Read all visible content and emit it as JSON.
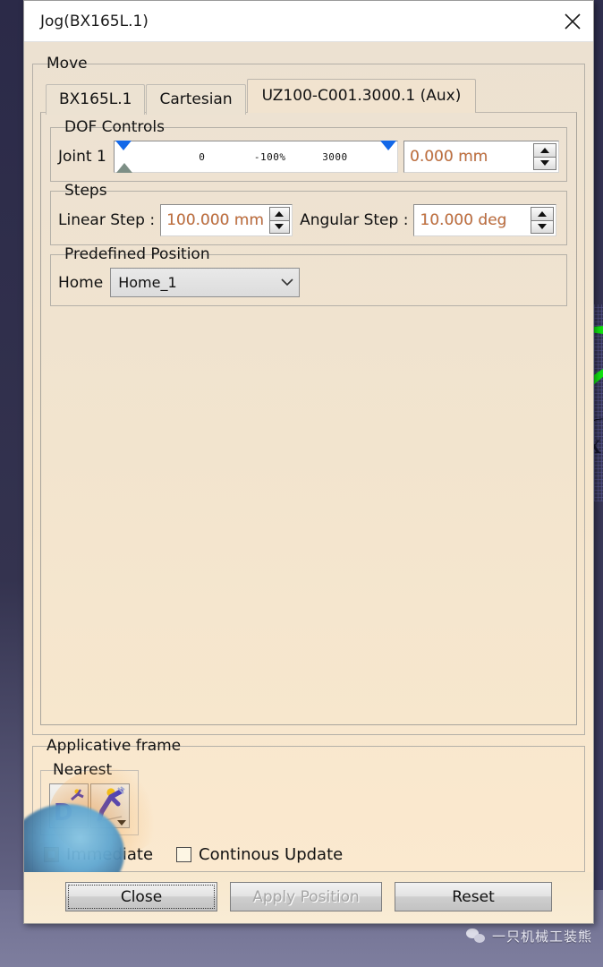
{
  "window": {
    "title": "Jog(BX165L.1)",
    "close_icon": "close-icon"
  },
  "move": {
    "legend": "Move",
    "tabs": [
      {
        "label": "BX165L.1",
        "active": false
      },
      {
        "label": "Cartesian",
        "active": false
      },
      {
        "label": "UZ100-C001.3000.1  (Aux)",
        "active": true
      }
    ]
  },
  "dof_controls": {
    "legend": "DOF Controls",
    "joint_label": "Joint 1",
    "slider": {
      "min_tick": "0",
      "mid_tick": "-100%",
      "max_tick": "3000",
      "low_thumb_color": "#1368e8",
      "high_thumb_color": "#1368e8",
      "current_thumb_color": "#7d8f86"
    },
    "value": "0.000 mm"
  },
  "steps": {
    "legend": "Steps",
    "linear_label": "Linear Step :",
    "linear_value": "100.000 mm",
    "angular_label": "Angular Step :",
    "angular_value": "10.000 deg"
  },
  "predefined_position": {
    "legend": "Predefined Position",
    "home_label": "Home",
    "home_value": "Home_1",
    "home_options": [
      "Home_1"
    ]
  },
  "applicative_frame": {
    "legend": "Applicative frame",
    "nearest_legend": "Nearest",
    "buttons": [
      {
        "name": "default-frame-icon",
        "glyph": "D"
      },
      {
        "name": "nearest-frame-icon",
        "glyph": ""
      }
    ]
  },
  "options": {
    "immediate_label": "Immediate",
    "immediate_checked": true,
    "continuous_label": "Continous Update",
    "continuous_checked": false
  },
  "footer": {
    "close_label": "Close",
    "apply_label": "Apply Position",
    "apply_disabled": true,
    "reset_label": "Reset"
  },
  "viewport": {
    "axis_x_label": "X"
  },
  "watermark": {
    "text": "一只机械工装熊",
    "icon": "wechat-icon"
  },
  "colors": {
    "dialog_bg": "#f0e7d9",
    "accent_value": "#c2703a",
    "slider_thumb": "#1368e8",
    "checkbox_checked": "#e08a22",
    "desktop": "#2b2a44"
  }
}
